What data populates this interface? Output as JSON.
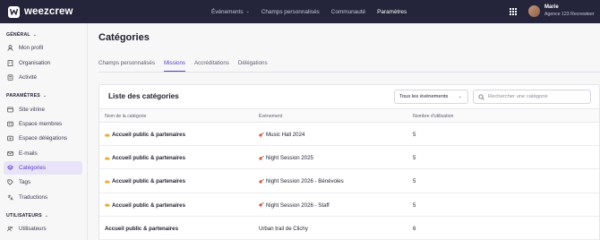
{
  "app": {
    "logo_text": "weezcrew",
    "nav": [
      {
        "label": "Événements",
        "has_dropdown": true,
        "active": false
      },
      {
        "label": "Champs personnalisés",
        "has_dropdown": false,
        "active": false
      },
      {
        "label": "Communauté",
        "has_dropdown": false,
        "active": false
      },
      {
        "label": "Paramètres",
        "has_dropdown": false,
        "active": true
      }
    ],
    "user": {
      "name": "Marie",
      "org": "Agence 123 Recrewteer"
    }
  },
  "sidebar": {
    "sections": [
      {
        "title": "GÉNÉRAL",
        "items": [
          {
            "label": "Mon profil",
            "icon": "user-icon"
          },
          {
            "label": "Organisation",
            "icon": "building-icon"
          },
          {
            "label": "Activité",
            "icon": "activity-icon"
          }
        ]
      },
      {
        "title": "PARAMÈTRES",
        "items": [
          {
            "label": "Site vitrine",
            "icon": "globe-icon"
          },
          {
            "label": "Espace membres",
            "icon": "members-icon"
          },
          {
            "label": "Espace délégations",
            "icon": "delegation-icon"
          },
          {
            "label": "E-mails",
            "icon": "mail-icon"
          },
          {
            "label": "Catégories",
            "icon": "category-icon",
            "active": true
          },
          {
            "label": "Tags",
            "icon": "tag-icon"
          },
          {
            "label": "Traductions",
            "icon": "translate-icon"
          }
        ]
      },
      {
        "title": "UTILISATEURS",
        "items": [
          {
            "label": "Utilisateurs",
            "icon": "users-icon"
          }
        ]
      }
    ]
  },
  "page": {
    "title": "Catégories",
    "tabs": [
      "Champs personnalisés",
      "Missions",
      "Accréditations",
      "Délégations"
    ],
    "active_tab": "Missions"
  },
  "list": {
    "title": "Liste des catégories",
    "event_filter": "Tous les événements",
    "search_placeholder": "Rechercher une catégorie",
    "columns": [
      "Nom de la catégorie",
      "Événement",
      "Nombre d'utilisation"
    ],
    "rows": [
      {
        "name": "Accueil public & partenaires",
        "name_emoji": "crown-emoji",
        "event": "Music Hall 2024",
        "event_emoji": "guitar-emoji",
        "count": "5"
      },
      {
        "name": "Accueil public & partenaires",
        "name_emoji": "crown-emoji",
        "event": "Night Session 2025",
        "event_emoji": "guitar-emoji",
        "count": "5"
      },
      {
        "name": "Accueil public & partenaires",
        "name_emoji": "crown-emoji",
        "event": "Night Session 2026 - Bénévoles",
        "event_emoji": "guitar-emoji",
        "count": "5"
      },
      {
        "name": "Accueil public & partenaires",
        "name_emoji": "crown-emoji",
        "event": "Night Session 2026 - Staff",
        "event_emoji": "guitar-emoji",
        "count": "5"
      },
      {
        "name": "Accueil public & partenaires",
        "name_emoji": "",
        "event": "Urban trail de Clichy",
        "event_emoji": "",
        "count": "6"
      }
    ]
  },
  "colors": {
    "topbar": "#24243a",
    "accent": "#5a3fc0",
    "active_bg": "#e8e3f8"
  }
}
